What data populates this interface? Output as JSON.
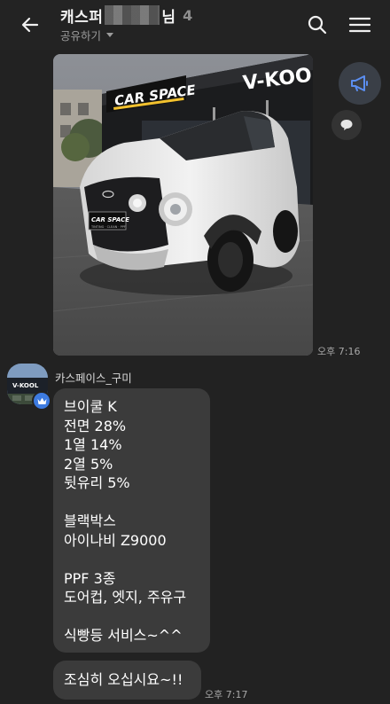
{
  "header": {
    "title_prefix": "캐스퍼",
    "title_suffix": "님",
    "member_count": "4",
    "share_label": "공유하기"
  },
  "photo_message": {
    "time": "오후 7:16",
    "sign_left": "CAR SPACE",
    "sign_right": "V-KOO",
    "plate_text": "CAR SPACE",
    "plate_sub": "TINTING · CLEAN · PPF"
  },
  "sender": {
    "name": "카스페이스_구미",
    "avatar_text": "V-KOOL"
  },
  "messages": [
    {
      "lines": [
        "브이쿨 K",
        "전면 28%",
        "1열 14%",
        "2열 5%",
        "뒷유리 5%",
        "",
        "블랙박스",
        "아이나비 Z9000",
        "",
        "PPF 3종",
        "도어컵, 엣지, 주유구",
        "",
        "식빵등 서비스~^^"
      ]
    },
    {
      "text": "조심히 오십시요~!!",
      "time": "오후 7:17"
    }
  ],
  "colors": {
    "background": "#222222",
    "bubble": "#3b3b3b",
    "accent": "#3d7be0"
  },
  "icons": {
    "back": "back-arrow-icon",
    "search": "search-icon",
    "menu": "hamburger-menu-icon",
    "notice": "megaphone-icon",
    "reply": "speech-bubble-icon",
    "badge": "crown-icon"
  }
}
